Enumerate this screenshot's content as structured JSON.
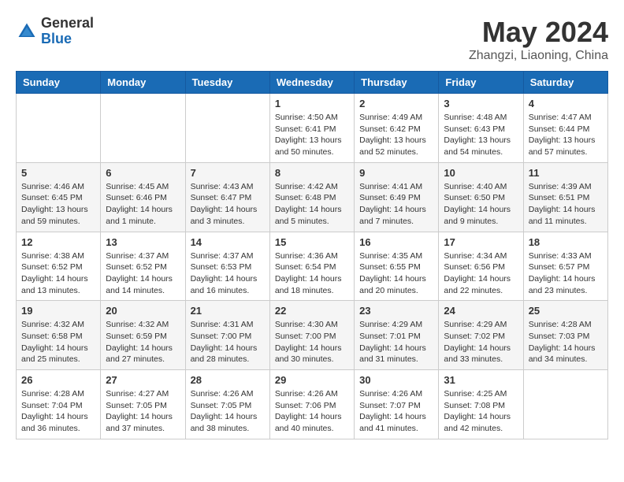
{
  "header": {
    "logo_general": "General",
    "logo_blue": "Blue",
    "title": "May 2024",
    "location": "Zhangzi, Liaoning, China"
  },
  "weekdays": [
    "Sunday",
    "Monday",
    "Tuesday",
    "Wednesday",
    "Thursday",
    "Friday",
    "Saturday"
  ],
  "weeks": [
    [
      {
        "day": "",
        "info": ""
      },
      {
        "day": "",
        "info": ""
      },
      {
        "day": "",
        "info": ""
      },
      {
        "day": "1",
        "info": "Sunrise: 4:50 AM\nSunset: 6:41 PM\nDaylight: 13 hours\nand 50 minutes."
      },
      {
        "day": "2",
        "info": "Sunrise: 4:49 AM\nSunset: 6:42 PM\nDaylight: 13 hours\nand 52 minutes."
      },
      {
        "day": "3",
        "info": "Sunrise: 4:48 AM\nSunset: 6:43 PM\nDaylight: 13 hours\nand 54 minutes."
      },
      {
        "day": "4",
        "info": "Sunrise: 4:47 AM\nSunset: 6:44 PM\nDaylight: 13 hours\nand 57 minutes."
      }
    ],
    [
      {
        "day": "5",
        "info": "Sunrise: 4:46 AM\nSunset: 6:45 PM\nDaylight: 13 hours\nand 59 minutes."
      },
      {
        "day": "6",
        "info": "Sunrise: 4:45 AM\nSunset: 6:46 PM\nDaylight: 14 hours\nand 1 minute."
      },
      {
        "day": "7",
        "info": "Sunrise: 4:43 AM\nSunset: 6:47 PM\nDaylight: 14 hours\nand 3 minutes."
      },
      {
        "day": "8",
        "info": "Sunrise: 4:42 AM\nSunset: 6:48 PM\nDaylight: 14 hours\nand 5 minutes."
      },
      {
        "day": "9",
        "info": "Sunrise: 4:41 AM\nSunset: 6:49 PM\nDaylight: 14 hours\nand 7 minutes."
      },
      {
        "day": "10",
        "info": "Sunrise: 4:40 AM\nSunset: 6:50 PM\nDaylight: 14 hours\nand 9 minutes."
      },
      {
        "day": "11",
        "info": "Sunrise: 4:39 AM\nSunset: 6:51 PM\nDaylight: 14 hours\nand 11 minutes."
      }
    ],
    [
      {
        "day": "12",
        "info": "Sunrise: 4:38 AM\nSunset: 6:52 PM\nDaylight: 14 hours\nand 13 minutes."
      },
      {
        "day": "13",
        "info": "Sunrise: 4:37 AM\nSunset: 6:52 PM\nDaylight: 14 hours\nand 14 minutes."
      },
      {
        "day": "14",
        "info": "Sunrise: 4:37 AM\nSunset: 6:53 PM\nDaylight: 14 hours\nand 16 minutes."
      },
      {
        "day": "15",
        "info": "Sunrise: 4:36 AM\nSunset: 6:54 PM\nDaylight: 14 hours\nand 18 minutes."
      },
      {
        "day": "16",
        "info": "Sunrise: 4:35 AM\nSunset: 6:55 PM\nDaylight: 14 hours\nand 20 minutes."
      },
      {
        "day": "17",
        "info": "Sunrise: 4:34 AM\nSunset: 6:56 PM\nDaylight: 14 hours\nand 22 minutes."
      },
      {
        "day": "18",
        "info": "Sunrise: 4:33 AM\nSunset: 6:57 PM\nDaylight: 14 hours\nand 23 minutes."
      }
    ],
    [
      {
        "day": "19",
        "info": "Sunrise: 4:32 AM\nSunset: 6:58 PM\nDaylight: 14 hours\nand 25 minutes."
      },
      {
        "day": "20",
        "info": "Sunrise: 4:32 AM\nSunset: 6:59 PM\nDaylight: 14 hours\nand 27 minutes."
      },
      {
        "day": "21",
        "info": "Sunrise: 4:31 AM\nSunset: 7:00 PM\nDaylight: 14 hours\nand 28 minutes."
      },
      {
        "day": "22",
        "info": "Sunrise: 4:30 AM\nSunset: 7:00 PM\nDaylight: 14 hours\nand 30 minutes."
      },
      {
        "day": "23",
        "info": "Sunrise: 4:29 AM\nSunset: 7:01 PM\nDaylight: 14 hours\nand 31 minutes."
      },
      {
        "day": "24",
        "info": "Sunrise: 4:29 AM\nSunset: 7:02 PM\nDaylight: 14 hours\nand 33 minutes."
      },
      {
        "day": "25",
        "info": "Sunrise: 4:28 AM\nSunset: 7:03 PM\nDaylight: 14 hours\nand 34 minutes."
      }
    ],
    [
      {
        "day": "26",
        "info": "Sunrise: 4:28 AM\nSunset: 7:04 PM\nDaylight: 14 hours\nand 36 minutes."
      },
      {
        "day": "27",
        "info": "Sunrise: 4:27 AM\nSunset: 7:05 PM\nDaylight: 14 hours\nand 37 minutes."
      },
      {
        "day": "28",
        "info": "Sunrise: 4:26 AM\nSunset: 7:05 PM\nDaylight: 14 hours\nand 38 minutes."
      },
      {
        "day": "29",
        "info": "Sunrise: 4:26 AM\nSunset: 7:06 PM\nDaylight: 14 hours\nand 40 minutes."
      },
      {
        "day": "30",
        "info": "Sunrise: 4:26 AM\nSunset: 7:07 PM\nDaylight: 14 hours\nand 41 minutes."
      },
      {
        "day": "31",
        "info": "Sunrise: 4:25 AM\nSunset: 7:08 PM\nDaylight: 14 hours\nand 42 minutes."
      },
      {
        "day": "",
        "info": ""
      }
    ]
  ]
}
